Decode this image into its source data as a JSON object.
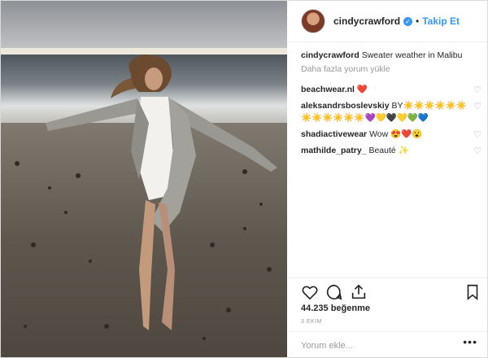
{
  "post": {
    "username": "cindycrawford",
    "follow_label": "Takip Et",
    "dot": "•",
    "caption_user": "cindycrawford",
    "caption_text": "Sweater weather in Malibu",
    "load_more": "Daha fazla yorum yükle",
    "likes": "44.235 beğenme",
    "date": "3 EKİM",
    "add_comment_placeholder": "Yorum ekle...",
    "more_options": "•••"
  },
  "comments": [
    {
      "user": "beachwear.nl",
      "text": "❤️"
    },
    {
      "user": "aleksandrsboslevskiy",
      "text": "BY☀️☀️☀️☀️☀️☀️☀️☀️☀️☀️☀️☀️💜💛🖤💛💚💙"
    },
    {
      "user": "shadiactivewear",
      "text": "Wow 😍❤️😮"
    },
    {
      "user": "mathilde_patry_",
      "text": "Beauté ✨"
    }
  ],
  "icons": [
    "heart-icon",
    "comment-icon",
    "share-icon",
    "bookmark-icon",
    "verified-icon"
  ],
  "colors": {
    "accent": "#3897f0",
    "text": "#262626",
    "muted": "#999999",
    "border": "#dbdbdb"
  }
}
